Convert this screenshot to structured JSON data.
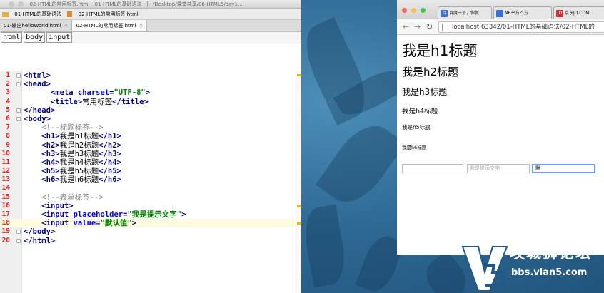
{
  "ide": {
    "window_title": "02-HTML的常用标签.html - 01-HTML的基础语法 - [~/Desktop/课堂共享/06-HTML5/day1...",
    "breadcrumb": [
      "01-HTML的基础语法",
      "02-HTML的常用标签.html"
    ],
    "tabs": [
      {
        "label": "01-输出helloWorld.html"
      },
      {
        "label": "02-HTML的常用标签.html"
      }
    ],
    "tag_path": [
      "html",
      "body",
      "input"
    ],
    "line_numbers": [
      "1",
      "2",
      "3",
      "4",
      "5",
      "6",
      "7",
      "8",
      "9",
      "10",
      "11",
      "12",
      "13",
      "14",
      "15",
      "16",
      "17",
      "18",
      "19",
      "20"
    ],
    "code": {
      "l4a": "UTF-8",
      "l4b": "常用标签",
      "l7": "<!--标题标签-->",
      "h1": "我是h1标题",
      "h2": "我是h2标题",
      "h3": "我是h3标题",
      "h4": "我是h4标题",
      "h5": "我是h5标题",
      "h6": "我是h6标题",
      "l15": "<!--表单标签-->",
      "placeholder": "我是提示文字",
      "value": "默认值"
    }
  },
  "browser": {
    "tabs": [
      {
        "label": "百度一下，你就"
      },
      {
        "label": "NB平方乙方"
      },
      {
        "label": "京东JD.COM"
      }
    ],
    "url": "localhost:63342/01-HTML的基础语法/02-HTML的",
    "headings": {
      "h1": "我是h1标题",
      "h2": "我是h2标题",
      "h3": "我是h3标题",
      "h4": "我是h4标题",
      "h5": "我是h5标题",
      "h6": "我是h6标题"
    },
    "inputs": {
      "first_value": "",
      "placeholder": "我是提示文字",
      "third_value": "默"
    }
  },
  "watermark": {
    "brand": "攻城狮论坛",
    "domain": "bbs.vlan5.com"
  },
  "colors": {
    "line_number": "#e0201a",
    "tag": "#000080",
    "attribute": "#0000ff",
    "string": "#008000",
    "comment": "#808080",
    "desktop": "#2e6a95"
  }
}
